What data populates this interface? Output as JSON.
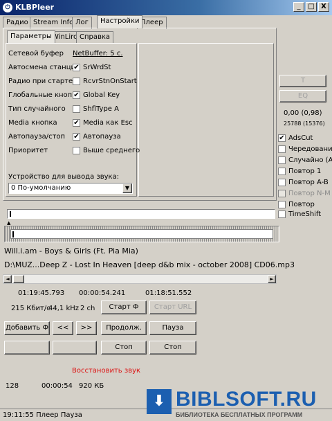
{
  "window": {
    "title": "KLBPleer",
    "icon": "power-icon",
    "controls": [
      "_",
      "□",
      "X"
    ]
  },
  "main_tabs": [
    "Радио",
    "Stream Info",
    "Лог",
    "Настройки",
    "Плеер"
  ],
  "sub_tabs": [
    "Параметры",
    "WinLirc",
    "Справка"
  ],
  "settings": {
    "rows": [
      {
        "label": "Сетевой буфер",
        "value": "NetBuffer: 5 с.",
        "checkbox": null
      },
      {
        "label": "Автосмена станции",
        "value": "SrWrdSt",
        "checked": true
      },
      {
        "label": "Радио при старте",
        "value": "RcvrStnOnStart",
        "checked": false
      },
      {
        "label": "Глобальные кнопки",
        "value": "Global Key",
        "checked": true
      },
      {
        "label": "Тип случайного",
        "value": "ShflType A",
        "checked": false
      },
      {
        "label": "Media кнопка",
        "value": "Media как Esc",
        "checked": true
      },
      {
        "label": "Автопауза/стоп",
        "value": "Автопауза",
        "checked": true
      },
      {
        "label": "Приоритет",
        "value": "Выше среднего",
        "checked": false
      }
    ],
    "device_label": "Устройство для вывода звука:",
    "device_value": "0  По-умолчанию"
  },
  "right_panel": {
    "t_button": "T",
    "eq_button": "EQ",
    "level": "0,00  (0,98)",
    "counter": "25788 (15376)",
    "checks": [
      {
        "label": "AdsCut",
        "checked": true,
        "disabled": false
      },
      {
        "label": "Чередование",
        "checked": false,
        "disabled": false
      },
      {
        "label": "Случайно (A)",
        "checked": false,
        "disabled": false
      },
      {
        "label": "Повтор 1",
        "checked": false,
        "disabled": false
      },
      {
        "label": "Повтор A-B",
        "checked": false,
        "disabled": false
      },
      {
        "label": "Повтор N-M",
        "checked": false,
        "disabled": true
      },
      {
        "label": "Повтор",
        "checked": false,
        "disabled": false
      }
    ],
    "timeshift": "TimeShift"
  },
  "track": {
    "title": "Will.i.am - Boys & Girls (Ft. Pia Mia)",
    "path": "D:\\MUZ...Deep Z - Lost In Heaven [deep d&b mix - october 2008] CD06.mp3"
  },
  "times": {
    "t1": "01:19:45.793",
    "t2": "00:00:54.241",
    "t3": "01:18:51.552"
  },
  "audio": {
    "bitrate": "215 Кбит/с",
    "freq": "44,1 kHz",
    "channels": "2 ch"
  },
  "buttons": {
    "start_f": "Старт Ф",
    "start_url": "Старт URL",
    "add_f": "Добавить Ф",
    "prev": "<<",
    "next": ">>",
    "continue": "Продолж.",
    "pause": "Пауза",
    "stop1": "Стоп",
    "stop2": "Стоп"
  },
  "restore_sound": "Восстановить звук",
  "footer_info": {
    "a": "128",
    "b": "00:00:54",
    "c": "920 КБ"
  },
  "status": "19:11:55 Плеер Пауза",
  "watermark": {
    "brand": "BIBLSOFT.RU",
    "tagline": "БИБЛИОТЕКА БЕСПЛАТНЫХ ПРОГРАММ"
  }
}
